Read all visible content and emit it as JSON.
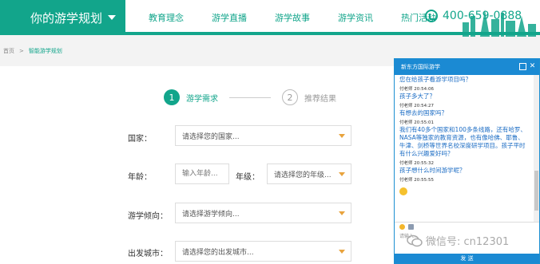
{
  "header": {
    "brand_title": "你的游学规划",
    "nav": [
      "教育理念",
      "游学直播",
      "游学故事",
      "游学资讯",
      "热门活动"
    ],
    "phone": "400-659-0888"
  },
  "breadcrumb": {
    "home": "首页",
    "separator": ">",
    "current": "智能游学规划"
  },
  "steps": [
    {
      "number": "1",
      "label": "游学需求"
    },
    {
      "number": "2",
      "label": "推荐结果"
    }
  ],
  "form": {
    "country_label": "国家：",
    "country_select": "请选择您的国家...",
    "age_label": "年龄：",
    "age_placeholder": "输入年龄...",
    "grade_label": "年级：",
    "grade_select": "请选择您的年级...",
    "intent_label": "游学倾向：",
    "intent_select": "请选择游学倾向...",
    "city_label": "出发城市：",
    "city_select": "请选择您的出发城市..."
  },
  "chat": {
    "title": "新东方国际游学",
    "messages": [
      {
        "type": "text",
        "text": "您在给孩子看游学项目吗？"
      },
      {
        "type": "meta",
        "text": "付老师 20:54:06"
      },
      {
        "type": "text",
        "text": "孩子多大了？"
      },
      {
        "type": "meta",
        "text": "付老师 20:54:27"
      },
      {
        "type": "text",
        "text": "有想去的国家吗？"
      },
      {
        "type": "meta",
        "text": "付老师 20:55:01"
      },
      {
        "type": "text",
        "text": "我们有40多个国家和100多条线路，还有哈罗、NASA等独家的教育资源，也有像哈佛、耶鲁、牛津、剑桥等世界名校深度研学项目。孩子平时有什么兴趣爱好吗？"
      },
      {
        "type": "meta",
        "text": "付老师 20:55:32"
      },
      {
        "type": "text",
        "text": "孩子想什么时间游学呢？"
      },
      {
        "type": "meta",
        "text": "付老师 20:55:55"
      }
    ],
    "input_placeholder": "请输入...",
    "send_label": "发 送"
  },
  "watermark": "微信号: cn12301",
  "colors": {
    "brand_green": "#12a58b",
    "chat_blue": "#1b8ad3",
    "arrow_orange": "#e8a33d"
  }
}
